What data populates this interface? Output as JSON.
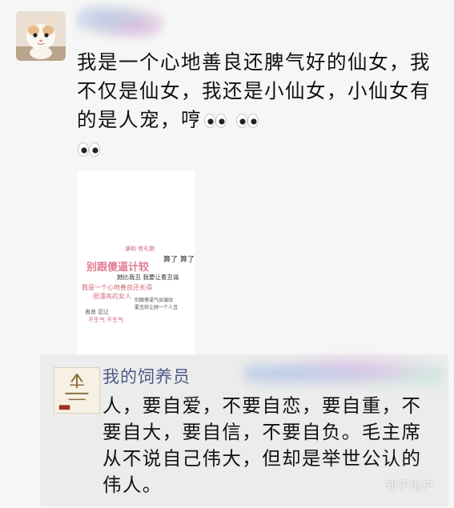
{
  "post": {
    "text": "我是一个心地善良还脾气好的仙女，我不仅是仙女，我还是小仙女，小仙女有的是人宠，哼",
    "emoji": "eyes"
  },
  "image_card": {
    "lines": [
      {
        "text": "谦和 有礼貌",
        "color": "#d06a7a"
      },
      {
        "text": "算了  算了",
        "color": "#333333"
      },
      {
        "text": "别跟傻逼计较",
        "color": "#e07e92"
      },
      {
        "text": "她比我丑  我要让着丑逼",
        "color": "#333333"
      },
      {
        "text": "我是一个心地善良还长得",
        "color": "#d06a7a"
      },
      {
        "text": "很漂亮的女人",
        "color": "#d06a7a"
      },
      {
        "text": "别跟傻逼气出皱纹",
        "color": "#555555"
      },
      {
        "text": "要丑就让她一个人丑",
        "color": "#555555"
      },
      {
        "text": "善良 忍让",
        "color": "#555555"
      },
      {
        "text": "不生气  不生气",
        "color": "#d06a7a"
      }
    ]
  },
  "reply": {
    "name": "我的饲养员",
    "text": "人，要自爱，不要自恋，要自重，不要自大，要自信，不要自负。毛主席从不说自己伟大，但却是举世公认的伟人。"
  },
  "watermark": "知乎用户"
}
